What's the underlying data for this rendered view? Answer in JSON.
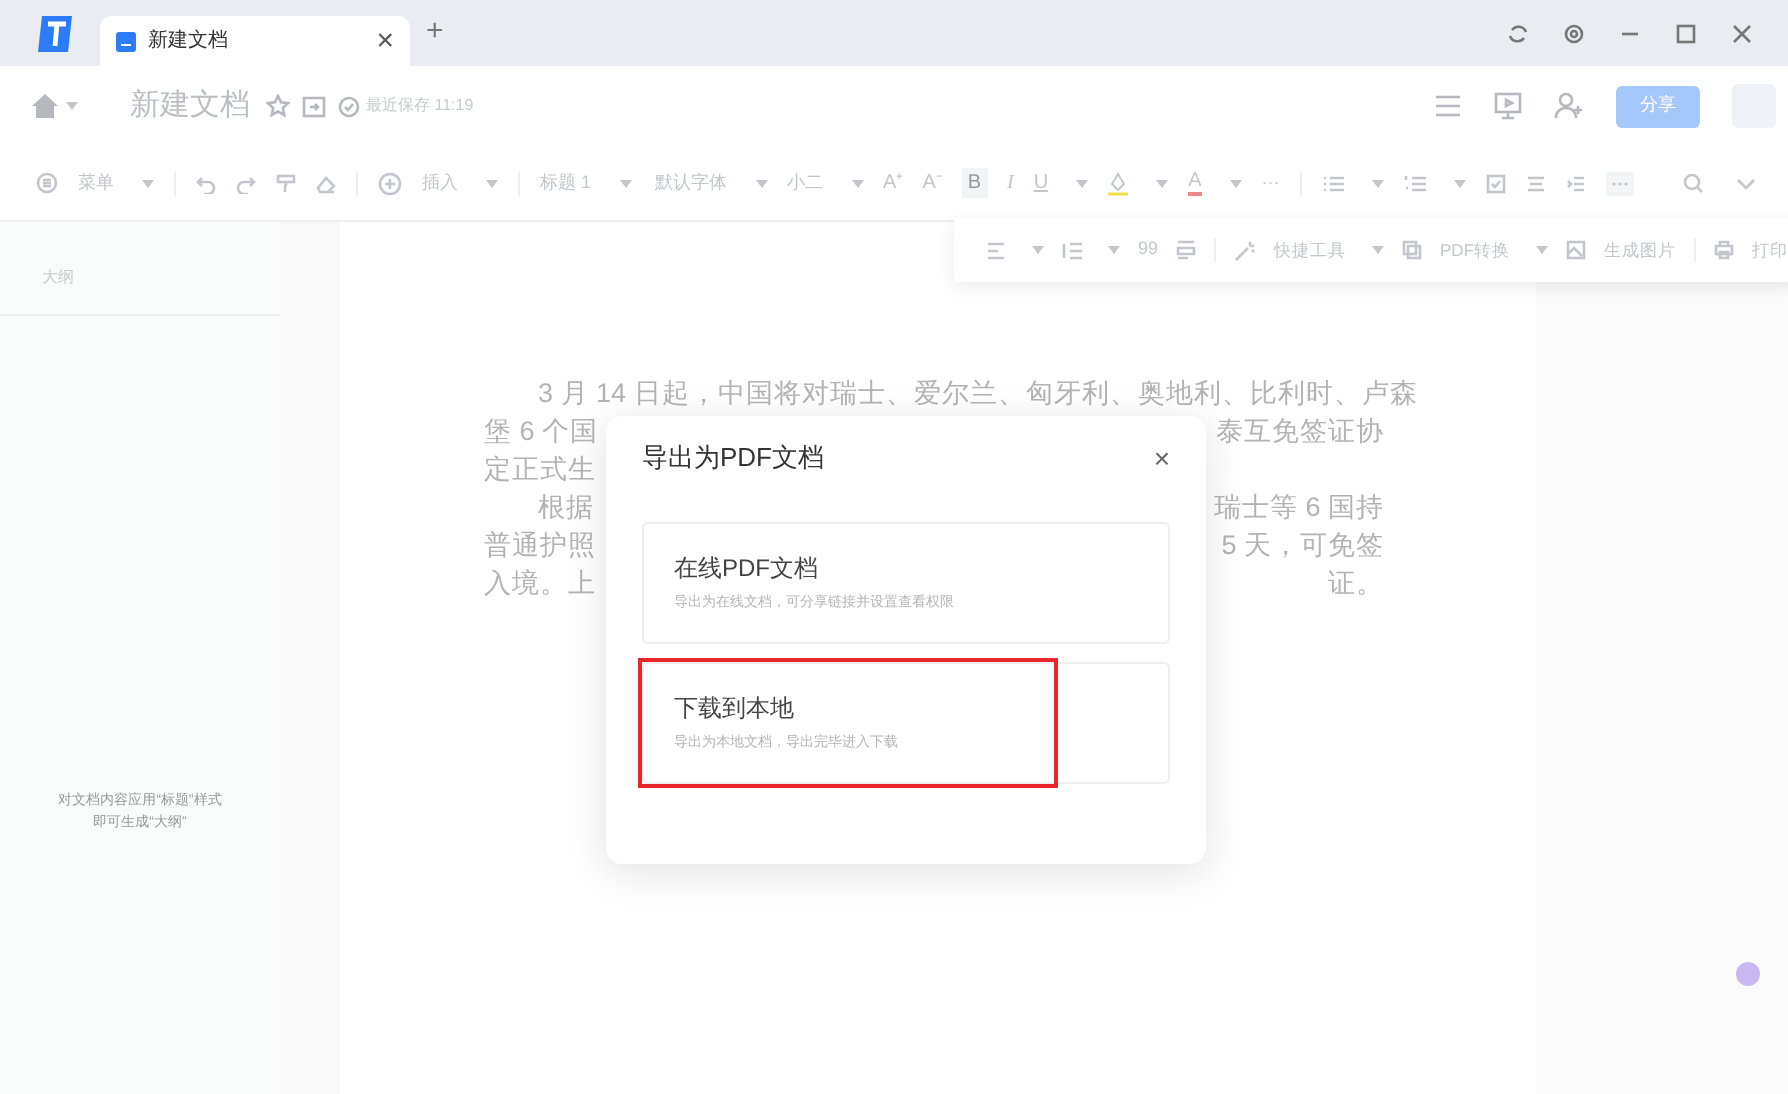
{
  "tab_bar": {
    "tab": {
      "title": "新建文档",
      "selected": true
    },
    "close": "×",
    "new_tab": "+"
  },
  "header": {
    "title": "新建文档",
    "save_status": "最近保存 11:19",
    "share": "分享"
  },
  "toolbar": {
    "menu": "菜单",
    "insert": "插入",
    "heading": "标题 1",
    "font": "默认字体",
    "size": "小二",
    "grow": "A⁺",
    "shrink": "A⁻",
    "bold": "B",
    "italic": "I",
    "underline": "U",
    "font_color": "A",
    "more": "···"
  },
  "toolbar_extra": {
    "quote": "99",
    "quick_tools": "快捷工具",
    "pdf_convert": "PDF转换",
    "make_image": "生成图片",
    "print": "打印"
  },
  "outline": {
    "title": "大纲",
    "hint_lines": [
      "对文档内容应用“标题”样式",
      "即可生成“大纲”"
    ]
  },
  "document": {
    "lines": [
      {
        "left": "3 月 14 日起，中国将对瑞士、爱尔兰、匈牙利、奥地利、比利时、卢森",
        "indent": true
      },
      {
        "left": "堡 6 个国",
        "right": "泰互免签证协",
        "indent": false
      },
      {
        "left": "定正式生",
        "indent": false
      },
      {
        "left": "根据",
        "right": "瑞士等 6 国持",
        "indent": true
      },
      {
        "left": "普通护照",
        "right": "5 天，可免签",
        "indent": false
      },
      {
        "left": "入境。上",
        "right": "证。",
        "indent": false
      }
    ]
  },
  "dialog": {
    "title": "导出为PDF文档",
    "close": "×",
    "options": [
      {
        "title": "在线PDF文档",
        "description": "导出为在线文档，可分享链接并设置查看权限",
        "highlighted": false
      },
      {
        "title": "下载到本地",
        "description": "导出为本地文档，导出完毕进入下载",
        "highlighted": true
      }
    ]
  }
}
